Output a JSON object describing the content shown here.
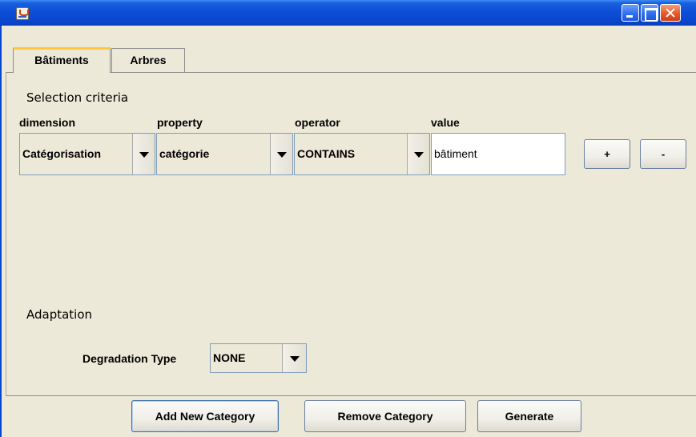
{
  "window": {
    "title": "",
    "controls": [
      "minimize-icon",
      "maximize-icon",
      "close-icon"
    ]
  },
  "tabs": [
    {
      "label": "Bâtiments",
      "selected": true
    },
    {
      "label": "Arbres",
      "selected": false
    }
  ],
  "selection": {
    "title": "Selection criteria",
    "headers": {
      "dimension": "dimension",
      "property": "property",
      "operator": "operator",
      "value": "value"
    },
    "criteria": [
      {
        "dimension": "Catégorisation",
        "property": "catégorie",
        "operator": "CONTAINS",
        "value": "bâtiment"
      }
    ],
    "add_label": "+",
    "remove_label": "-"
  },
  "adaptation": {
    "title": "Adaptation",
    "degradation_label": "Degradation Type",
    "degradation_value": "NONE"
  },
  "footer": {
    "add_category": "Add New Category",
    "remove_category": "Remove Category",
    "generate": "Generate"
  },
  "colors": {
    "titlebar": "#0a46cf",
    "background": "#ece9d8",
    "active_tab_accent": "#ffc83c",
    "close_button": "#e35a2a"
  }
}
